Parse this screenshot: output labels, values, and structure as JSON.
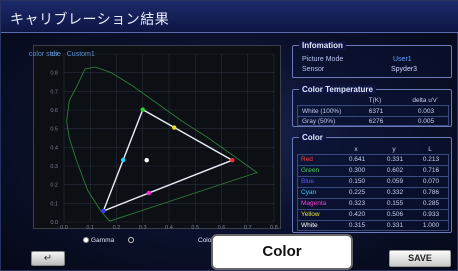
{
  "window": {
    "title": "キャリブレーション結果"
  },
  "chart_caption": {
    "label": "color stdie",
    "mode": "Custom1"
  },
  "chart_data": {
    "type": "scatter",
    "x_ticks": [
      "0.0",
      "0.1",
      "0.2",
      "0.3",
      "0.4",
      "0.5",
      "0.6",
      "0.7",
      "0.8"
    ],
    "y_ticks": [
      "0.9",
      "0.8",
      "0.7",
      "0.6",
      "0.5",
      "0.4",
      "0.3",
      "0.2",
      "0.1",
      "0.0"
    ],
    "xlim": [
      0,
      0.8
    ],
    "ylim": [
      0,
      0.9
    ],
    "measured": {
      "red": [
        0.641,
        0.331
      ],
      "green": [
        0.3,
        0.602
      ],
      "blue": [
        0.15,
        0.059
      ],
      "cyan": [
        0.225,
        0.332
      ],
      "magenta": [
        0.323,
        0.155
      ],
      "yellow": [
        0.42,
        0.506
      ],
      "white": [
        0.315,
        0.331
      ]
    },
    "target": {
      "red": [
        0.64,
        0.33
      ],
      "green": [
        0.3,
        0.6
      ],
      "blue": [
        0.15,
        0.06
      ]
    },
    "point_colors": {
      "red": "#ff2a2a",
      "green": "#34d23a",
      "blue": "#3a3aff",
      "cyan": "#2ad0ff",
      "magenta": "#ff2ad6",
      "yellow": "#e6e62a",
      "white": "#ffffff"
    }
  },
  "info": {
    "title": "Infomation",
    "rows": [
      {
        "label": "Picture Mode",
        "value": "User1"
      },
      {
        "label": "Sensor",
        "value": "Spyder3"
      }
    ]
  },
  "color_temp": {
    "title": "Color Temperature",
    "headers": [
      "T(K)",
      "delta u'v'"
    ],
    "rows": [
      {
        "label": "White (100%)",
        "t": "6371",
        "delta": "0.003"
      },
      {
        "label": "Gray (50%)",
        "t": "6276",
        "delta": "0.005"
      }
    ]
  },
  "color_table": {
    "title": "Color",
    "headers": [
      "x",
      "y",
      "L"
    ],
    "rows": [
      {
        "label": "Red",
        "color": "#ff3a3a",
        "x": "0.641",
        "y": "0.331",
        "L": "0.213"
      },
      {
        "label": "Green",
        "color": "#3ad24a",
        "x": "0.300",
        "y": "0.602",
        "L": "0.716"
      },
      {
        "label": "Blue",
        "color": "#5a5aff",
        "x": "0.150",
        "y": "0.059",
        "L": "0.070"
      },
      {
        "label": "Cyan",
        "color": "#3ad0ff",
        "x": "0.225",
        "y": "0.332",
        "L": "0.786"
      },
      {
        "label": "Magenta",
        "color": "#ff3ad6",
        "x": "0.323",
        "y": "0.155",
        "L": "0.285"
      },
      {
        "label": "Yellow",
        "color": "#e6e63a",
        "x": "0.420",
        "y": "0.506",
        "L": "0.933"
      },
      {
        "label": "White",
        "color": "#ffffff",
        "x": "0.315",
        "y": "0.331",
        "L": "1.000"
      }
    ]
  },
  "bottom": {
    "back_icon": "return-arrow-icon",
    "back_glyph": "↵",
    "radio_gamma": "Gamma",
    "radio_color_temp": "Color Temp",
    "save_label": "SAVE"
  },
  "callout": {
    "label": "Color"
  }
}
